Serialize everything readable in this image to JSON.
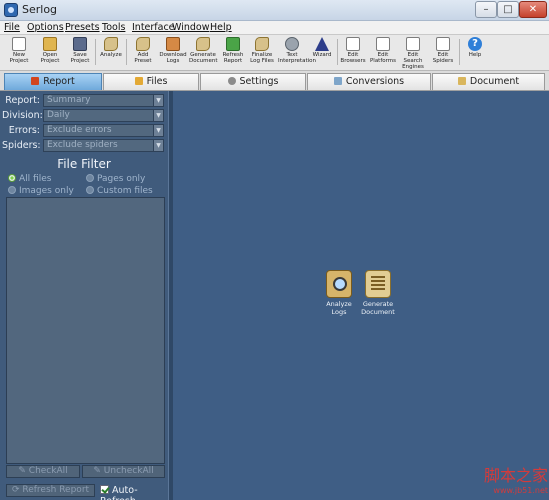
{
  "window": {
    "title": "Serlog",
    "min_label": "–",
    "max_label": "□",
    "close_label": "✕"
  },
  "menu": [
    "File",
    "Options",
    "Presets",
    "Tools",
    "Interface",
    "Window",
    "Help"
  ],
  "toolbar": [
    {
      "label": "New Project",
      "icon": "new-project-icon"
    },
    {
      "label": "Open Project",
      "icon": "open-project-icon"
    },
    {
      "label": "Save Project",
      "icon": "save-project-icon"
    },
    {
      "label": "Analyze",
      "icon": "analyze-icon"
    },
    {
      "label": "Add Preset",
      "icon": "add-preset-icon"
    },
    {
      "label": "Download Logs",
      "icon": "download-logs-icon"
    },
    {
      "label": "Generate Document",
      "icon": "generate-document-icon"
    },
    {
      "label": "Refresh Report",
      "icon": "refresh-report-icon"
    },
    {
      "label": "Finalize Log Files",
      "icon": "finalize-log-files-icon"
    },
    {
      "label": "Text Interpretation",
      "icon": "text-interpretation-icon"
    },
    {
      "label": "Wizard",
      "icon": "wizard-icon"
    },
    {
      "label": "Edit Browsers",
      "icon": "edit-browsers-icon"
    },
    {
      "label": "Edit Platforms",
      "icon": "edit-platforms-icon"
    },
    {
      "label": "Edit Search Engines",
      "icon": "edit-search-engines-icon"
    },
    {
      "label": "Edit Spiders",
      "icon": "edit-spiders-icon"
    },
    {
      "label": "Help",
      "icon": "help-icon"
    }
  ],
  "tabs": [
    {
      "label": "Report",
      "active": true
    },
    {
      "label": "Files"
    },
    {
      "label": "Settings"
    },
    {
      "label": "Conversions"
    },
    {
      "label": "Document"
    }
  ],
  "filters": {
    "report": {
      "label": "Report:",
      "value": "Summary"
    },
    "division": {
      "label": "Division:",
      "value": "Daily"
    },
    "errors": {
      "label": "Errors:",
      "value": "Exclude errors"
    },
    "spiders": {
      "label": "Spiders:",
      "value": "Exclude spiders"
    }
  },
  "file_filter": {
    "title": "File Filter",
    "options": {
      "all_files": "All files",
      "pages_only": "Pages only",
      "images_only": "Images only",
      "custom_files": "Custom files"
    },
    "selected": "All files"
  },
  "buttons": {
    "check_all": "CheckAll",
    "uncheck_all": "UncheckAll",
    "refresh_report": "Refresh Report",
    "auto_refresh": "Auto-Refresh"
  },
  "auto_refresh_checked": true,
  "main_actions": [
    {
      "label_line1": "Analyze",
      "label_line2": "Logs"
    },
    {
      "label_line1": "Generate",
      "label_line2": "Document"
    }
  ],
  "watermark": {
    "line1": "脚本之家",
    "line2": "www.jb51.net"
  },
  "colors": {
    "left_panel": "#405b7c",
    "main_area": "#3f5e85",
    "active_tab": "#6fa9db"
  }
}
